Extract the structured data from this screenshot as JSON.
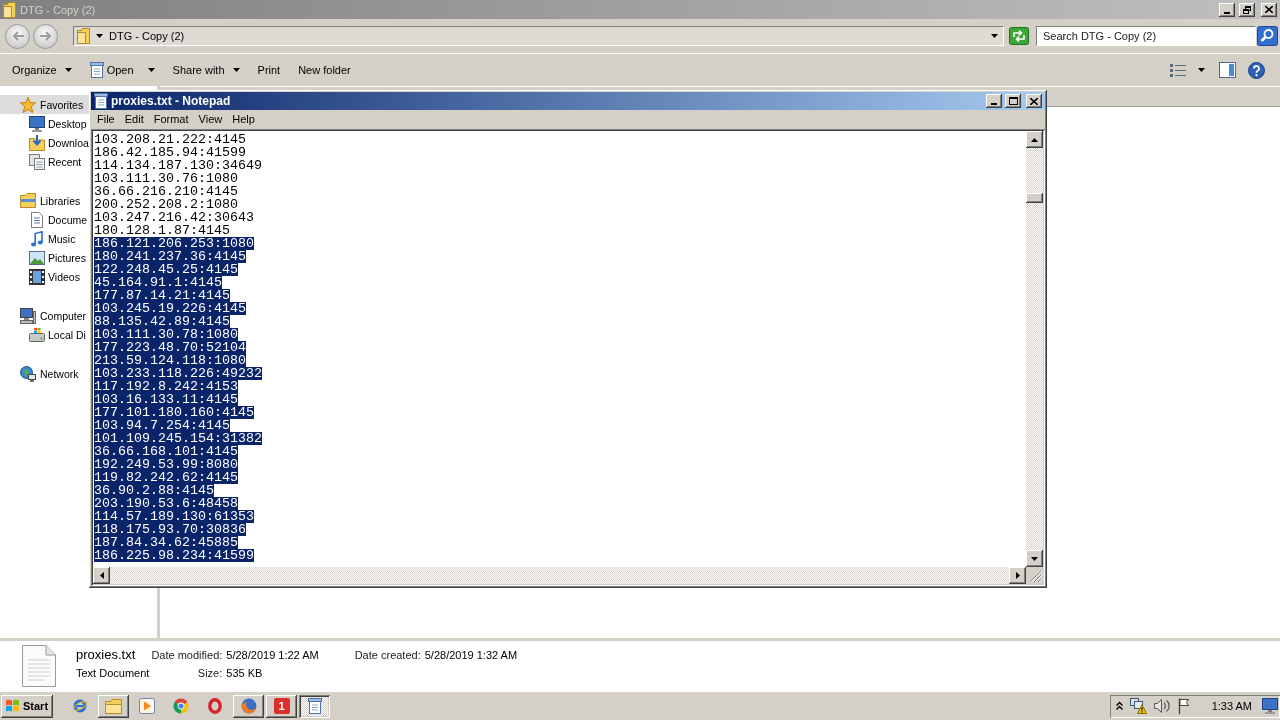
{
  "explorer": {
    "title": "DTG - Copy (2)",
    "active": false,
    "maximized": true,
    "address": "DTG - Copy (2)",
    "search": {
      "placeholder": "Search DTG - Copy (2)"
    },
    "toolbar": [
      {
        "label": "Organize",
        "kind": "menu"
      },
      {
        "label": "Open",
        "kind": "split"
      },
      {
        "label": "Share with",
        "kind": "menu"
      },
      {
        "label": "Print",
        "kind": "plain"
      },
      {
        "label": "New folder",
        "kind": "plain"
      }
    ],
    "nav": [
      {
        "label": "Favorites",
        "selected": true,
        "children": [
          {
            "label": "Desktop",
            "selected": false
          },
          {
            "label": "Downloa",
            "selected": false
          },
          {
            "label": "Recent",
            "selected": false
          }
        ]
      },
      {
        "label": "Libraries",
        "selected": false,
        "children": [
          {
            "label": "Docume",
            "selected": false
          },
          {
            "label": "Music",
            "selected": false
          },
          {
            "label": "Pictures",
            "selected": false
          },
          {
            "label": "Videos",
            "selected": false
          }
        ]
      },
      {
        "label": "Computer",
        "selected": false,
        "children": [
          {
            "label": "Local Di",
            "selected": false
          }
        ]
      },
      {
        "label": "Network",
        "selected": false
      }
    ],
    "details": {
      "name": "proxies.txt",
      "type": "Text Document",
      "field_columns": [
        [
          {
            "label": "Date modified:",
            "value": "5/28/2019 1:22 AM"
          },
          {
            "label": "Size:",
            "value": "535 KB"
          }
        ],
        [
          {
            "label": "Date created:",
            "value": "5/28/2019 1:32 AM"
          }
        ]
      ]
    }
  },
  "notepad": {
    "title": "proxies.txt - Notepad",
    "active": true,
    "maximized": false,
    "menu": [
      "File",
      "Edit",
      "Format",
      "View",
      "Help"
    ],
    "lines": [
      {
        "text": "103.208.21.222:4145",
        "selected": false
      },
      {
        "text": "186.42.185.94:41599",
        "selected": false
      },
      {
        "text": "114.134.187.130:34649",
        "selected": false
      },
      {
        "text": "103.111.30.76:1080",
        "selected": false
      },
      {
        "text": "36.66.216.210:4145",
        "selected": false
      },
      {
        "text": "200.252.208.2:1080",
        "selected": false
      },
      {
        "text": "103.247.216.42:30643",
        "selected": false
      },
      {
        "text": "180.128.1.87:4145",
        "selected": false
      },
      {
        "text": "186.121.206.253:1080",
        "selected": true
      },
      {
        "text": "180.241.237.36:4145",
        "selected": true
      },
      {
        "text": "122.248.45.25:4145",
        "selected": true
      },
      {
        "text": "45.164.91.1:4145",
        "selected": true
      },
      {
        "text": "177.87.14.21:4145",
        "selected": true
      },
      {
        "text": "103.245.19.226:4145",
        "selected": true
      },
      {
        "text": "88.135.42.89:4145",
        "selected": true
      },
      {
        "text": "103.111.30.78:1080",
        "selected": true
      },
      {
        "text": "177.223.48.70:52104",
        "selected": true
      },
      {
        "text": "213.59.124.118:1080",
        "selected": true
      },
      {
        "text": "103.233.118.226:49232",
        "selected": true
      },
      {
        "text": "117.192.8.242:4153",
        "selected": true
      },
      {
        "text": "103.16.133.11:4145",
        "selected": true
      },
      {
        "text": "177.101.180.160:4145",
        "selected": true
      },
      {
        "text": "103.94.7.254:4145",
        "selected": true
      },
      {
        "text": "101.109.245.154:31382",
        "selected": true
      },
      {
        "text": "36.66.168.101:4145",
        "selected": true
      },
      {
        "text": "192.249.53.99:8080",
        "selected": true
      },
      {
        "text": "119.82.242.62:4145",
        "selected": true
      },
      {
        "text": "36.90.2.88:4145",
        "selected": true
      },
      {
        "text": "203.190.53.6:48458",
        "selected": true
      },
      {
        "text": "114.57.189.130:61353",
        "selected": true
      },
      {
        "text": "118.175.93.70:30836",
        "selected": true
      },
      {
        "text": "187.84.34.62:45885",
        "selected": true
      },
      {
        "text": "186.225.98.234:41599",
        "selected": true
      }
    ]
  },
  "taskbar": {
    "start": "Start",
    "items": [
      {
        "kind": "launcher"
      },
      {
        "kind": "window",
        "selected": false
      },
      {
        "kind": "launcher"
      },
      {
        "kind": "launcher"
      },
      {
        "kind": "launcher"
      },
      {
        "kind": "window",
        "selected": false
      },
      {
        "kind": "window",
        "selected": false,
        "label": "1"
      },
      {
        "kind": "window",
        "selected": true
      }
    ],
    "clock": "1:33 AM"
  }
}
